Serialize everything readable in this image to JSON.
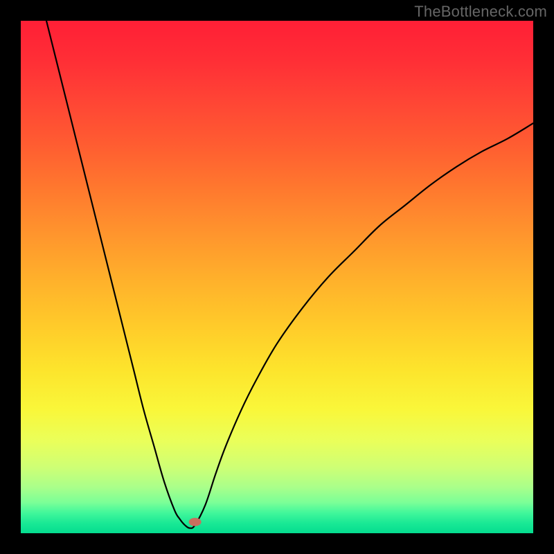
{
  "watermark": "TheBottleneck.com",
  "chart_data": {
    "type": "line",
    "title": "",
    "xlabel": "",
    "ylabel": "",
    "xlim": [
      0,
      100
    ],
    "ylim": [
      0,
      100
    ],
    "notch_x": 33,
    "marker": {
      "x": 34,
      "y": 2.2
    },
    "series": [
      {
        "name": "curve",
        "x": [
          0,
          2,
          4,
          6,
          8,
          10,
          12,
          14,
          16,
          18,
          20,
          22,
          24,
          26,
          28,
          30,
          31,
          32,
          33,
          34,
          36,
          38,
          40,
          43,
          46,
          50,
          55,
          60,
          65,
          70,
          75,
          80,
          85,
          90,
          95,
          100
        ],
        "values": [
          120,
          112,
          104,
          96,
          88,
          80,
          72,
          64,
          56,
          48,
          40,
          32,
          24,
          17,
          10,
          4.5,
          2.8,
          1.6,
          1.0,
          1.6,
          5.5,
          11.5,
          17,
          24,
          30,
          37,
          44,
          50,
          55,
          60,
          64,
          68,
          71.5,
          74.5,
          77,
          80
        ]
      }
    ],
    "gradient_stops": [
      {
        "pct": 0,
        "color": "#ff1f36"
      },
      {
        "pct": 8,
        "color": "#ff2f36"
      },
      {
        "pct": 15,
        "color": "#ff4335"
      },
      {
        "pct": 24,
        "color": "#ff5c31"
      },
      {
        "pct": 33,
        "color": "#ff792e"
      },
      {
        "pct": 42,
        "color": "#ff962d"
      },
      {
        "pct": 51,
        "color": "#ffb22b"
      },
      {
        "pct": 60,
        "color": "#ffcc2a"
      },
      {
        "pct": 68,
        "color": "#fde42c"
      },
      {
        "pct": 76,
        "color": "#f9f73a"
      },
      {
        "pct": 82,
        "color": "#eaff5a"
      },
      {
        "pct": 87,
        "color": "#cfff74"
      },
      {
        "pct": 91,
        "color": "#aaff8a"
      },
      {
        "pct": 94,
        "color": "#7bff97"
      },
      {
        "pct": 96,
        "color": "#42f79b"
      },
      {
        "pct": 98,
        "color": "#1ae995"
      },
      {
        "pct": 100,
        "color": "#04dd8f"
      }
    ],
    "marker_color": "#c86f5e"
  }
}
